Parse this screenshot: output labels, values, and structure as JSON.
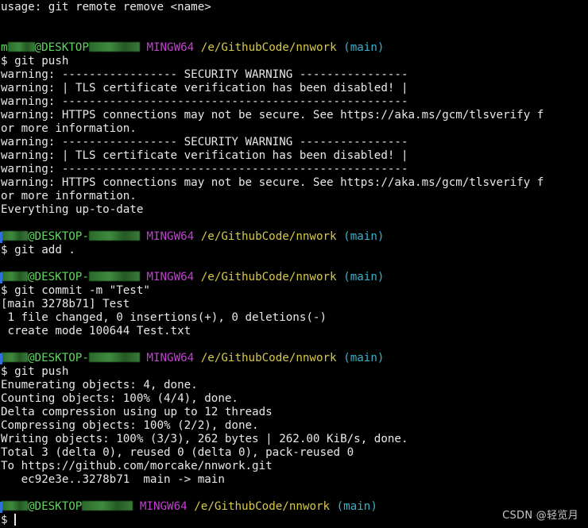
{
  "terminal": {
    "lines": [
      {
        "type": "text",
        "text": "usage: git remote remove <name>"
      },
      {
        "type": "blank"
      },
      {
        "type": "blank"
      },
      {
        "type": "prompt",
        "user": "m",
        "host": "@DESKTOP",
        "system": "MINGW64",
        "path": "/e/GithubCode/nnwork",
        "branch": "(main)"
      },
      {
        "type": "text",
        "text": "$ git push"
      },
      {
        "type": "text",
        "text": "warning: ----------------- SECURITY WARNING ----------------"
      },
      {
        "type": "text",
        "text": "warning: | TLS certificate verification has been disabled! |"
      },
      {
        "type": "text",
        "text": "warning: ---------------------------------------------------"
      },
      {
        "type": "text",
        "text": "warning: HTTPS connections may not be secure. See https://aka.ms/gcm/tlsverify f"
      },
      {
        "type": "text",
        "text": "or more information."
      },
      {
        "type": "text",
        "text": "warning: ----------------- SECURITY WARNING ----------------"
      },
      {
        "type": "text",
        "text": "warning: | TLS certificate verification has been disabled! |"
      },
      {
        "type": "text",
        "text": "warning: ---------------------------------------------------"
      },
      {
        "type": "text",
        "text": "warning: HTTPS connections may not be secure. See https://aka.ms/gcm/tlsverify f"
      },
      {
        "type": "text",
        "text": "or more information."
      },
      {
        "type": "text",
        "text": "Everything up-to-date"
      },
      {
        "type": "blank"
      },
      {
        "type": "prompt",
        "user": "",
        "host": "@DESKTOP-",
        "system": "MINGW64",
        "path": "/e/GithubCode/nnwork",
        "branch": "(main)"
      },
      {
        "type": "text",
        "text": "$ git add ."
      },
      {
        "type": "blank"
      },
      {
        "type": "prompt",
        "user": "",
        "host": "@DESKTOP-",
        "system": "MINGW64",
        "path": "/e/GithubCode/nnwork",
        "branch": "(main)"
      },
      {
        "type": "text",
        "text": "$ git commit -m \"Test\""
      },
      {
        "type": "text",
        "text": "[main 3278b71] Test"
      },
      {
        "type": "text",
        "text": " 1 file changed, 0 insertions(+), 0 deletions(-)"
      },
      {
        "type": "text",
        "text": " create mode 100644 Test.txt"
      },
      {
        "type": "blank"
      },
      {
        "type": "prompt",
        "user": "",
        "host": "@DESKTOP-",
        "system": "MINGW64",
        "path": "/e/GithubCode/nnwork",
        "branch": "(main)"
      },
      {
        "type": "text",
        "text": "$ git push"
      },
      {
        "type": "text",
        "text": "Enumerating objects: 4, done."
      },
      {
        "type": "text",
        "text": "Counting objects: 100% (4/4), done."
      },
      {
        "type": "text",
        "text": "Delta compression using up to 12 threads"
      },
      {
        "type": "text",
        "text": "Compressing objects: 100% (2/2), done."
      },
      {
        "type": "text",
        "text": "Writing objects: 100% (3/3), 262 bytes | 262.00 KiB/s, done."
      },
      {
        "type": "text",
        "text": "Total 3 (delta 0), reused 0 (delta 0), pack-reused 0"
      },
      {
        "type": "text",
        "text": "To https://github.com/morcake/nnwork.git"
      },
      {
        "type": "text",
        "text": "   ec92e3e..3278b71  main -> main"
      },
      {
        "type": "blank"
      },
      {
        "type": "prompt",
        "user": "",
        "host": "@DESKTOP",
        "system": "MINGW64",
        "path": "/e/GithubCode/nnwork",
        "branch": "(main)"
      },
      {
        "type": "cursor",
        "text": "$ "
      }
    ]
  },
  "watermark": "CSDN @轻览月",
  "colors": {
    "background": "#000000",
    "text": "#e8e8e8",
    "user_host": "#5fd75f",
    "system": "#c43fd4",
    "path": "#d7c94a",
    "branch": "#3ab0c8"
  }
}
